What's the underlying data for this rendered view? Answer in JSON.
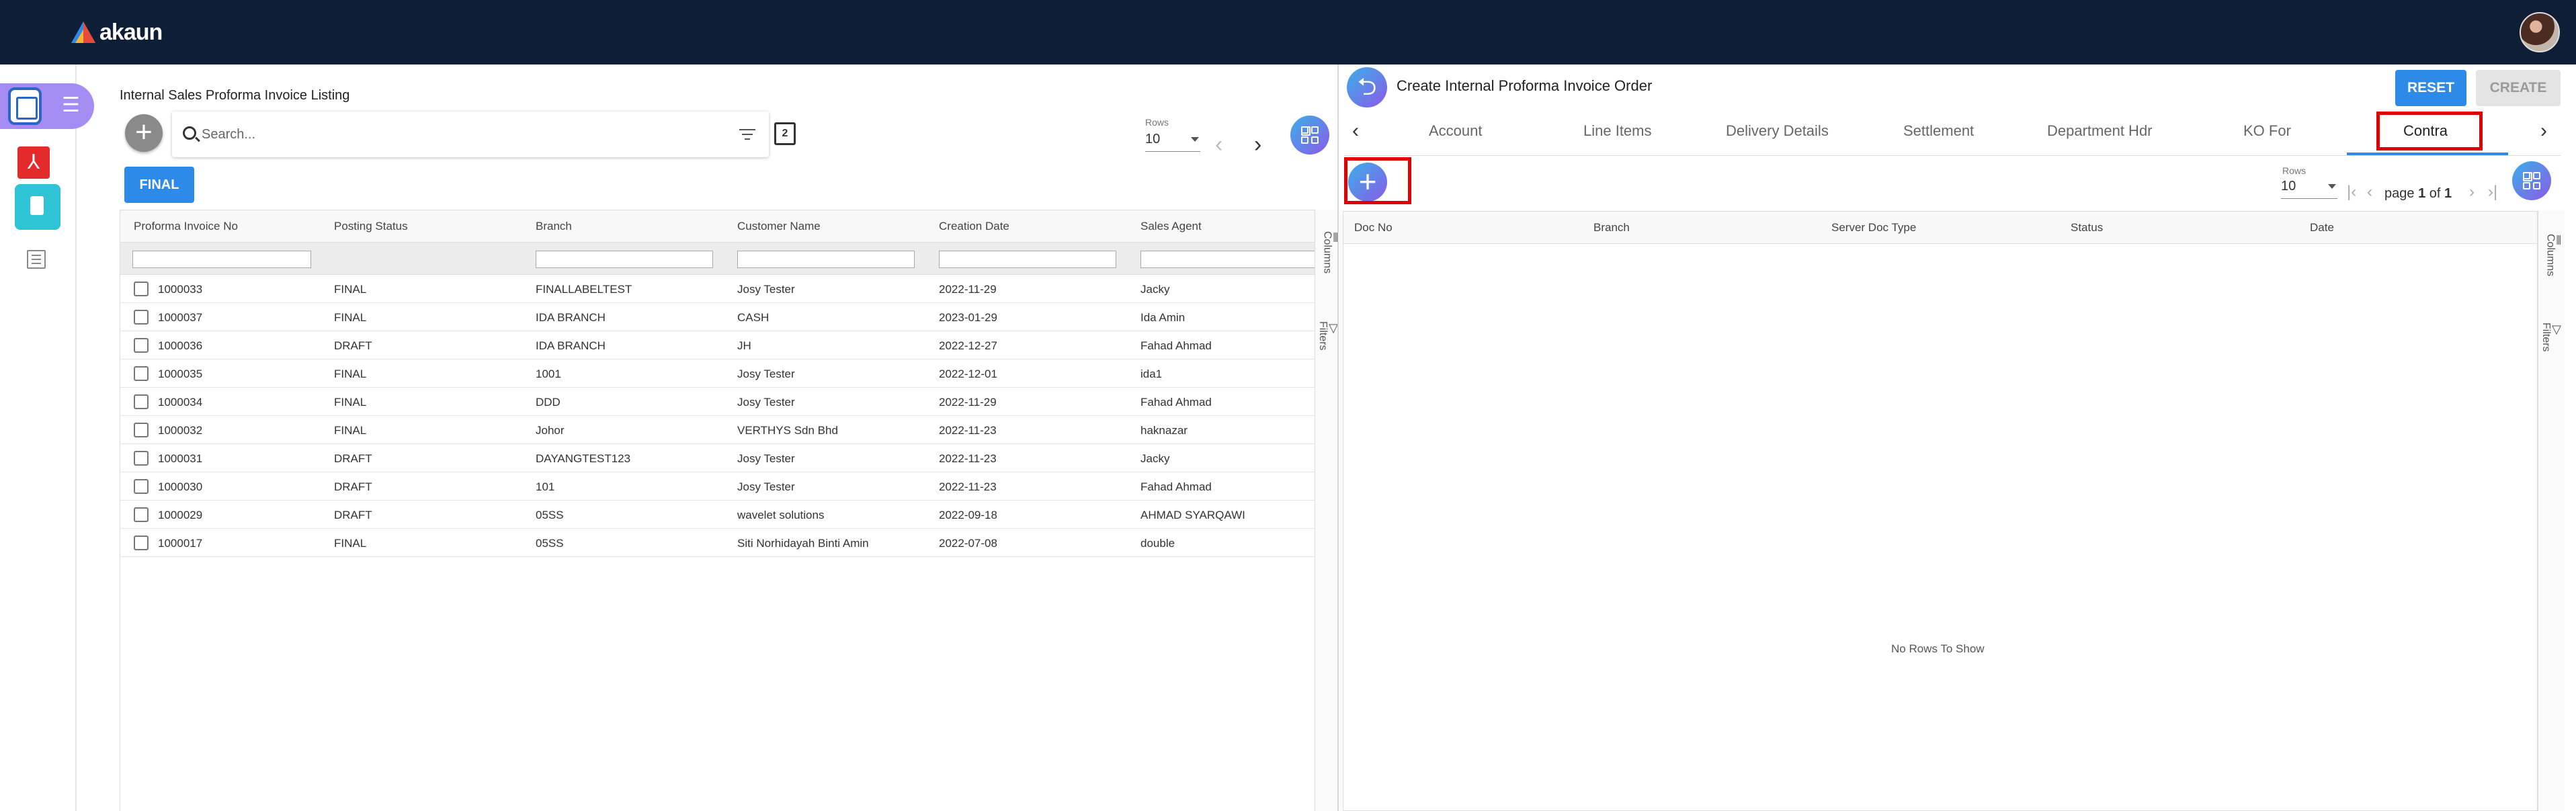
{
  "app": {
    "brand": "akaun"
  },
  "left_panel": {
    "title": "Internal Sales Proforma Invoice Listing",
    "search": {
      "placeholder": "Search...",
      "value": ""
    },
    "rows_label": "Rows",
    "rows_value": "10",
    "status_filter": "FINAL",
    "columns": [
      "Proforma Invoice No",
      "Posting Status",
      "Branch",
      "Customer Name",
      "Creation Date",
      "Sales Agent"
    ],
    "rows": [
      [
        "1000033",
        "FINAL",
        "FINALLABELTEST",
        "Josy Tester",
        "2022-11-29",
        "Jacky"
      ],
      [
        "1000037",
        "FINAL",
        "IDA BRANCH",
        "CASH",
        "2023-01-29",
        "Ida Amin"
      ],
      [
        "1000036",
        "DRAFT",
        "IDA BRANCH",
        "JH",
        "2022-12-27",
        "Fahad Ahmad"
      ],
      [
        "1000035",
        "FINAL",
        "1001",
        "Josy Tester",
        "2022-12-01",
        "ida1"
      ],
      [
        "1000034",
        "FINAL",
        "DDD",
        "Josy Tester",
        "2022-11-29",
        "Fahad Ahmad"
      ],
      [
        "1000032",
        "FINAL",
        "Johor",
        "VERTHYS Sdn Bhd",
        "2022-11-23",
        "haknazar"
      ],
      [
        "1000031",
        "DRAFT",
        "DAYANGTEST123",
        "Josy Tester",
        "2022-11-23",
        "Jacky"
      ],
      [
        "1000030",
        "DRAFT",
        "101",
        "Josy Tester",
        "2022-11-23",
        "Fahad Ahmad"
      ],
      [
        "1000029",
        "DRAFT",
        "05SS",
        "wavelet solutions",
        "2022-09-18",
        "AHMAD SYARQAWI"
      ],
      [
        "1000017",
        "FINAL",
        "05SS",
        "Siti Norhidayah Binti Amin",
        "2022-07-08",
        "double"
      ]
    ],
    "side_tools": {
      "columns": "Columns",
      "filters": "Filters"
    }
  },
  "right_panel": {
    "title": "Create Internal Proforma Invoice Order",
    "reset_label": "RESET",
    "create_label": "CREATE",
    "tabs": [
      "Account",
      "Line Items",
      "Delivery Details",
      "Settlement",
      "Department Hdr",
      "KO For",
      "Contra"
    ],
    "active_tab": "Contra",
    "rows_label": "Rows",
    "rows_value": "10",
    "pager": {
      "page_word": "page",
      "page": "1",
      "of_word": "of",
      "total": "1"
    },
    "columns": [
      "Doc No",
      "Branch",
      "Server Doc Type",
      "Status",
      "Date"
    ],
    "empty_message": "No Rows To Show",
    "side_tools": {
      "columns": "Columns",
      "filters": "Filters"
    }
  },
  "colors": {
    "topbar": "#0f1e37",
    "primary": "#2d8ae8",
    "highlight": "#e00000",
    "accent_gradient_start": "#3ab0e8",
    "accent_gradient_end": "#8a5ae8"
  },
  "icons": [
    "akaun-logo-icon",
    "user-avatar-icon",
    "document-icon",
    "menu-icon",
    "pdf-icon",
    "doc-icon",
    "list-icon",
    "add-icon",
    "search-icon",
    "filter-icon",
    "copy-icon",
    "chevron-left-icon",
    "chevron-right-icon",
    "grid-view-icon",
    "back-icon",
    "first-page-icon",
    "prev-page-icon",
    "next-page-icon",
    "last-page-icon"
  ]
}
